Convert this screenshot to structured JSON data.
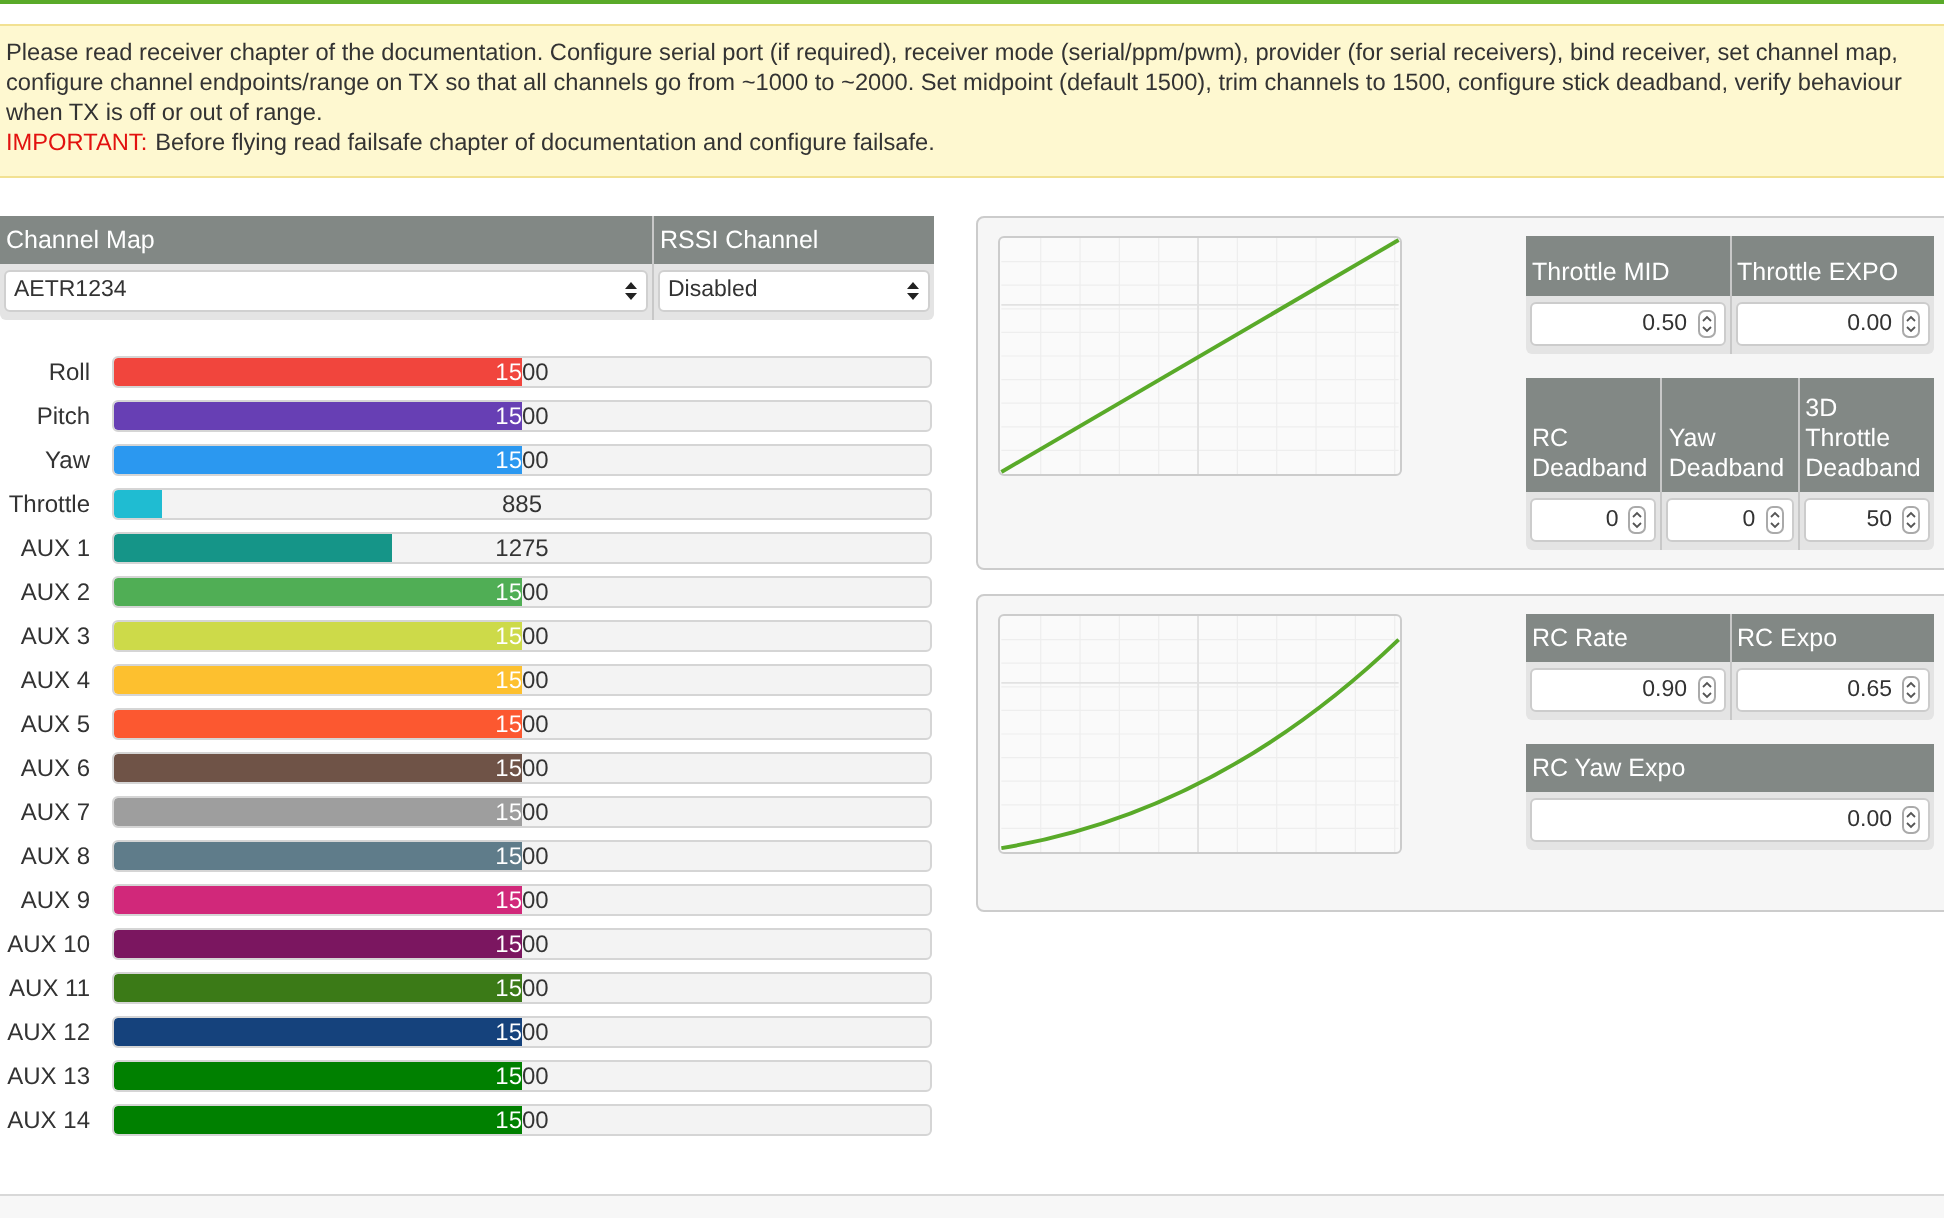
{
  "notice": {
    "text": "Please read receiver chapter of the documentation. Configure serial port (if required), receiver mode (serial/ppm/pwm), provider (for serial receivers), bind receiver, set channel map, configure channel endpoints/range on TX so that all channels go from ~1000 to ~2000. Set midpoint (default 1500), trim channels to 1500, configure stick deadband, verify behaviour when TX is off or out of range.",
    "important_label": "IMPORTANT:",
    "important_text": "Before flying read failsafe chapter of documentation and configure failsafe."
  },
  "receiver": {
    "columns": [
      {
        "label": "Channel Map",
        "value": "AETR1234"
      },
      {
        "label": "RSSI Channel",
        "value": "Disabled"
      }
    ]
  },
  "channels": [
    {
      "name": "Roll",
      "reading": "1500",
      "level": 0.5,
      "color": "#f1453d"
    },
    {
      "name": "Pitch",
      "reading": "1500",
      "level": 0.5,
      "color": "#673fb4"
    },
    {
      "name": "Yaw",
      "reading": "1500",
      "level": 0.5,
      "color": "#2b98f0"
    },
    {
      "name": "Throttle",
      "reading": "885",
      "level": 0.06,
      "color": "#1fbcd2"
    },
    {
      "name": "AUX 1",
      "reading": "1275",
      "level": 0.34,
      "color": "#159588"
    },
    {
      "name": "AUX 2",
      "reading": "1500",
      "level": 0.5,
      "color": "#50ae55"
    },
    {
      "name": "AUX 3",
      "reading": "1500",
      "level": 0.5,
      "color": "#cdda49"
    },
    {
      "name": "AUX 4",
      "reading": "1500",
      "level": 0.5,
      "color": "#fdc02f"
    },
    {
      "name": "AUX 5",
      "reading": "1500",
      "level": 0.5,
      "color": "#fc5830"
    },
    {
      "name": "AUX 6",
      "reading": "1500",
      "level": 0.5,
      "color": "#6f5347"
    },
    {
      "name": "AUX 7",
      "reading": "1500",
      "level": 0.5,
      "color": "#9e9e9e"
    },
    {
      "name": "AUX 8",
      "reading": "1500",
      "level": 0.5,
      "color": "#5f7c8a"
    },
    {
      "name": "AUX 9",
      "reading": "1500",
      "level": 0.5,
      "color": "#d1287a"
    },
    {
      "name": "AUX 10",
      "reading": "1500",
      "level": 0.5,
      "color": "#7b1660"
    },
    {
      "name": "AUX 11",
      "reading": "1500",
      "level": 0.5,
      "color": "#3b7a17"
    },
    {
      "name": "AUX 12",
      "reading": "1500",
      "level": 0.5,
      "color": "#15427c"
    },
    {
      "name": "AUX 13",
      "reading": "1500",
      "level": 0.5,
      "color": "#008000"
    },
    {
      "name": "AUX 14",
      "reading": "1500",
      "level": 0.5,
      "color": "#008000"
    }
  ],
  "throttle_panel": {
    "curve": {
      "kind": "linear"
    },
    "tables": [
      [
        {
          "label": "Throttle MID",
          "value": "0.50"
        },
        {
          "label": "Throttle EXPO",
          "value": "0.00"
        }
      ],
      [
        {
          "label": "RC Deadband",
          "value": "0"
        },
        {
          "label": "Yaw Deadband",
          "value": "0"
        },
        {
          "label": "3D Throttle Deadband",
          "value": "50"
        }
      ]
    ]
  },
  "rate_panel": {
    "curve": {
      "kind": "expo"
    },
    "tables": [
      [
        {
          "label": "RC Rate",
          "value": "0.90"
        },
        {
          "label": "RC Expo",
          "value": "0.65"
        }
      ],
      [
        {
          "label": "RC Yaw Expo",
          "value": "0.00"
        }
      ]
    ]
  }
}
